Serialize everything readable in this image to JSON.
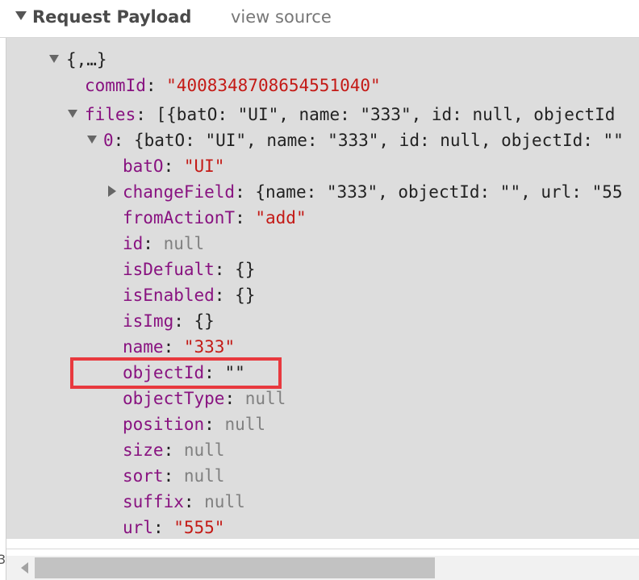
{
  "header": {
    "title": "Request Payload",
    "view_source_label": "view source"
  },
  "edge_fragment": "3",
  "payload": {
    "root": {
      "label": "{,…}"
    },
    "commId": {
      "key": "commId",
      "value": "\"4008348708654551040\""
    },
    "files": {
      "key": "files",
      "preview": "[{batO: \"UI\", name: \"333\", id: null, objectId"
    },
    "item0": {
      "key": "0",
      "preview": "{batO: \"UI\", name: \"333\", id: null, objectId: \"\""
    },
    "props": {
      "batO": {
        "key": "batO",
        "value": "\"UI\""
      },
      "changeField": {
        "key": "changeField",
        "preview": "{name: \"333\", objectId: \"\", url: \"55"
      },
      "fromActionT": {
        "key": "fromActionT",
        "value": "\"add\""
      },
      "id": {
        "key": "id",
        "value": "null"
      },
      "isDefualt": {
        "key": "isDefualt",
        "value": "{}"
      },
      "isEnabled": {
        "key": "isEnabled",
        "value": "{}"
      },
      "isImg": {
        "key": "isImg",
        "value": "{}"
      },
      "name": {
        "key": "name",
        "value": "\"333\""
      },
      "objectId": {
        "key": "objectId",
        "value": "\"\""
      },
      "objectType": {
        "key": "objectType",
        "value": "null"
      },
      "position": {
        "key": "position",
        "value": "null"
      },
      "size": {
        "key": "size",
        "value": "null"
      },
      "sort": {
        "key": "sort",
        "value": "null"
      },
      "suffix": {
        "key": "suffix",
        "value": "null"
      },
      "url": {
        "key": "url",
        "value": "\"555\""
      }
    }
  },
  "colors": {
    "key": "#881280",
    "string": "#c41a16",
    "null": "#808080",
    "highlight": "#e8393e",
    "panel_bg": "#dddddd"
  },
  "icons": {
    "section_toggle": "triangle-down-icon",
    "expanded": "triangle-down-icon",
    "collapsed": "triangle-right-icon",
    "scroll_left": "arrow-left-icon"
  }
}
